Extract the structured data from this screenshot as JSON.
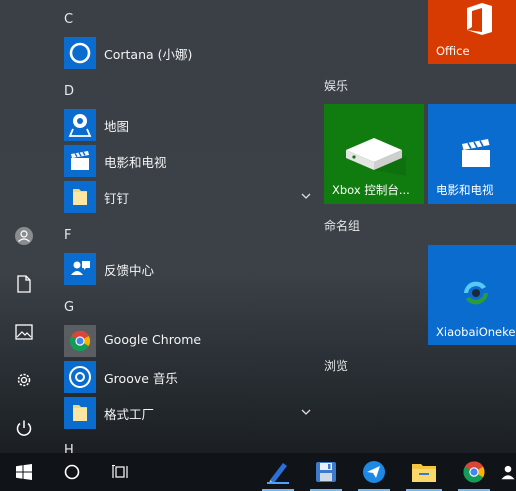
{
  "app_list": {
    "sections": [
      {
        "letter": "C",
        "apps": [
          {
            "name": "Cortana (小娜)",
            "icon": "cortana-icon"
          }
        ]
      },
      {
        "letter": "D",
        "apps": [
          {
            "name": "地图",
            "icon": "maps-icon"
          },
          {
            "name": "电影和电视",
            "icon": "movies-tv-icon"
          },
          {
            "name": "钉钉",
            "icon": "folder-icon",
            "expandable": true
          }
        ]
      },
      {
        "letter": "F",
        "apps": [
          {
            "name": "反馈中心",
            "icon": "feedback-hub-icon"
          }
        ]
      },
      {
        "letter": "G",
        "apps": [
          {
            "name": "Google Chrome",
            "icon": "chrome-icon"
          },
          {
            "name": "Groove 音乐",
            "icon": "groove-music-icon"
          },
          {
            "name": "格式工厂",
            "icon": "folder-icon",
            "expandable": true
          }
        ]
      },
      {
        "letter": "H",
        "apps": []
      }
    ]
  },
  "tile_area": {
    "top_tile_label": "Office",
    "groups": [
      {
        "name": "娱乐",
        "tiles": [
          "Xbox 控制台...",
          "电影和电视"
        ]
      },
      {
        "name": "命名组",
        "tiles": [
          "XiaobaiOnekey"
        ]
      },
      {
        "name": "浏览",
        "tiles": []
      }
    ]
  },
  "rail": [
    "user-icon",
    "documents-icon",
    "pictures-icon",
    "settings-icon",
    "power-icon"
  ],
  "taskbar": [
    "windows-start-icon",
    "cortana-search-icon",
    "task-view-icon",
    "pen-app-icon",
    "floppy-save-icon",
    "send-app-icon",
    "file-explorer-icon",
    "chrome-icon",
    "user-app-icon"
  ],
  "colors": {
    "accent_blue": "#0a6ccf",
    "office_orange": "#d83b01",
    "xbox_green": "#107c10",
    "taskbar": "#101418"
  }
}
